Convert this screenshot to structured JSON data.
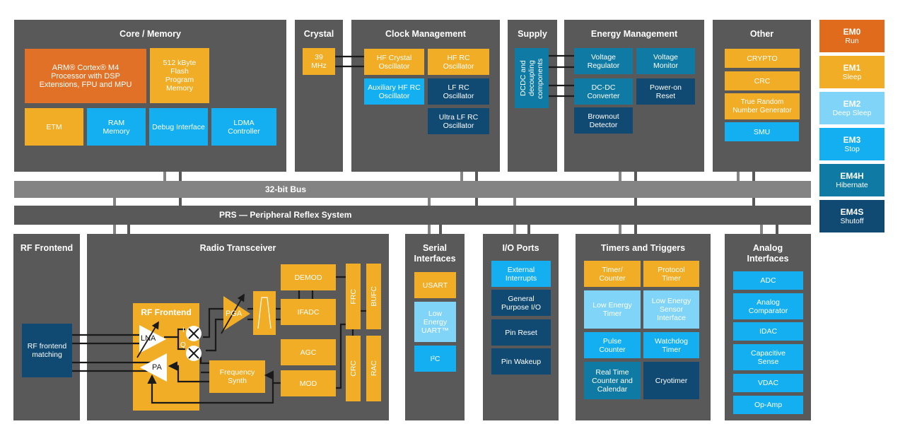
{
  "top_row": {
    "core_memory": {
      "title": "Core / Memory",
      "cpu": "ARM® Cortex® M4 Processor with DSP Extensions, FPU and MPU",
      "flash": "512 kByte Flash Program Memory",
      "etm": "ETM",
      "ram": "RAM Memory",
      "debug": "Debug Interface",
      "ldma": "LDMA Controller"
    },
    "crystal": {
      "title": "Crystal",
      "freq": "39 MHz"
    },
    "clock_management": {
      "title": "Clock Management",
      "hf_crystal": "HF Crystal Oscillator",
      "hf_rc": "HF RC Oscillator",
      "aux_hf_rc": "Auxiliary HF RC Oscillator",
      "lf_rc": "LF RC Oscillator",
      "ulf_rc": "Ultra LF RC Oscillator"
    },
    "supply": {
      "title": "Supply",
      "dcdc": "DCDC and decoupling components"
    },
    "energy_management": {
      "title": "Energy Management",
      "voltage_regulator": "Voltage Regulator",
      "voltage_monitor": "Voltage Monitor",
      "dcdc_converter": "DC-DC Converter",
      "power_on_reset": "Power-on Reset",
      "brownout": "Brownout Detector"
    },
    "other": {
      "title": "Other",
      "items": [
        "CRYPTO",
        "CRC",
        "True Random Number Generator",
        "SMU"
      ]
    }
  },
  "buses": {
    "bus32": "32-bit Bus",
    "prs": "PRS — Peripheral Reflex System"
  },
  "bottom_row": {
    "rf_frontend": {
      "title": "RF Frontend",
      "matching": "RF frontend matching"
    },
    "radio": {
      "title": "Radio Transceiver",
      "inner_title": "RF Frontend",
      "lna": "LNA",
      "pa": "PA",
      "i_label": "I",
      "q_label": "Q",
      "pga": "PGA",
      "demod": "DEMOD",
      "ifadc": "IFADC",
      "agc": "AGC",
      "mod": "MOD",
      "freq_synth": "Frequency Synth",
      "frc": "FRC",
      "bufc": "BUFC",
      "crc": "CRC",
      "rac": "RAC"
    },
    "serial": {
      "title": "Serial Interfaces",
      "usart": "USART",
      "leuart": "Low Energy UART™",
      "i2c": "I²C"
    },
    "io_ports": {
      "title": "I/O Ports",
      "items": [
        "External Interrupts",
        "General Purpose I/O",
        "Pin Reset",
        "Pin Wakeup"
      ]
    },
    "timers": {
      "title": "Timers and Triggers",
      "timer_counter": "Timer/ Counter",
      "protocol_timer": "Protocol Timer",
      "le_timer": "Low Energy Timer",
      "lesense": "Low Energy Sensor Interface",
      "pulse_counter": "Pulse Counter",
      "watchdog": "Watchdog Timer",
      "rtcc": "Real Time Counter and Calendar",
      "cryotimer": "Cryotimer"
    },
    "analog": {
      "title": "Analog Interfaces",
      "items": [
        "ADC",
        "Analog Comparator",
        "IDAC",
        "Capacitive Sense",
        "VDAC",
        "Op-Amp"
      ]
    }
  },
  "energy_modes": [
    {
      "code": "EM0",
      "name": "Run",
      "color": "#e06b1c"
    },
    {
      "code": "EM1",
      "name": "Sleep",
      "color": "#f1ad25"
    },
    {
      "code": "EM2",
      "name": "Deep Sleep",
      "color": "#7fd4f7"
    },
    {
      "code": "EM3",
      "name": "Stop",
      "color": "#14aff0"
    },
    {
      "code": "EM4H",
      "name": "Hibernate",
      "color": "#0f7aa3"
    },
    {
      "code": "EM4S",
      "name": "Shutoff",
      "color": "#104a73"
    }
  ],
  "colors": {
    "panel": "#595959",
    "bus32": "#838383",
    "orange": "#e07126",
    "amber": "#f1ad25",
    "sky": "#14aff0",
    "pale": "#7fd4f7",
    "teal": "#0f7aa3",
    "navy": "#104a73"
  }
}
